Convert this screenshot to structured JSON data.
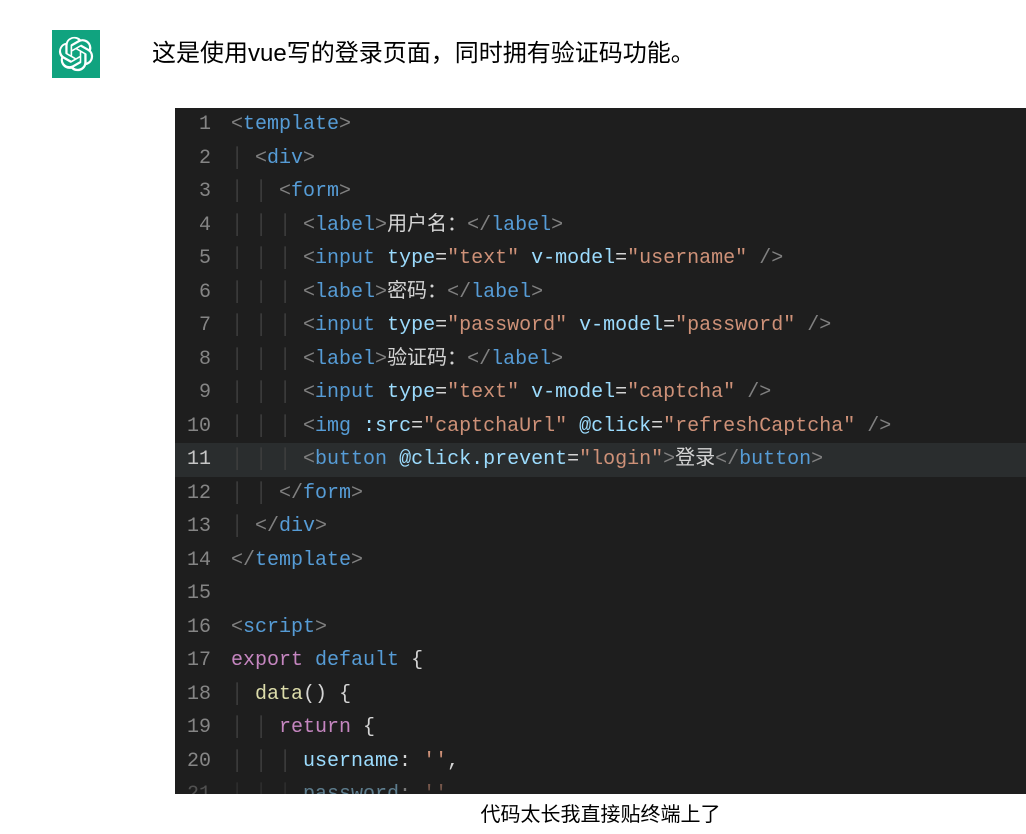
{
  "message": {
    "text": "这是使用vue写的登录页面，同时拥有验证码功能。"
  },
  "caption": "代码太长我直接贴终端上了",
  "code": {
    "lines": [
      {
        "n": "1",
        "indent": "",
        "tokens": [
          {
            "t": "tag-bracket",
            "v": "<"
          },
          {
            "t": "tag-name",
            "v": "template"
          },
          {
            "t": "tag-bracket",
            "v": ">"
          }
        ]
      },
      {
        "n": "2",
        "indent": "│ ",
        "tokens": [
          {
            "t": "tag-bracket",
            "v": "<"
          },
          {
            "t": "tag-name",
            "v": "div"
          },
          {
            "t": "tag-bracket",
            "v": ">"
          }
        ]
      },
      {
        "n": "3",
        "indent": "│ │ ",
        "tokens": [
          {
            "t": "tag-bracket",
            "v": "<"
          },
          {
            "t": "tag-name",
            "v": "form"
          },
          {
            "t": "tag-bracket",
            "v": ">"
          }
        ]
      },
      {
        "n": "4",
        "indent": "│ │ │ ",
        "tokens": [
          {
            "t": "tag-bracket",
            "v": "<"
          },
          {
            "t": "tag-name",
            "v": "label"
          },
          {
            "t": "tag-bracket",
            "v": ">"
          },
          {
            "t": "text-content",
            "v": "用户名："
          },
          {
            "t": "tag-bracket",
            "v": "</"
          },
          {
            "t": "tag-name",
            "v": "label"
          },
          {
            "t": "tag-bracket",
            "v": ">"
          }
        ]
      },
      {
        "n": "5",
        "indent": "│ │ │ ",
        "tokens": [
          {
            "t": "tag-bracket",
            "v": "<"
          },
          {
            "t": "tag-name",
            "v": "input"
          },
          {
            "t": "text-content",
            "v": " "
          },
          {
            "t": "attr-name",
            "v": "type"
          },
          {
            "t": "eq",
            "v": "="
          },
          {
            "t": "attr-value",
            "v": "\"text\""
          },
          {
            "t": "text-content",
            "v": " "
          },
          {
            "t": "attr-name",
            "v": "v-model"
          },
          {
            "t": "eq",
            "v": "="
          },
          {
            "t": "attr-value",
            "v": "\"username\""
          },
          {
            "t": "text-content",
            "v": " "
          },
          {
            "t": "tag-bracket",
            "v": "/>"
          }
        ]
      },
      {
        "n": "6",
        "indent": "│ │ │ ",
        "tokens": [
          {
            "t": "tag-bracket",
            "v": "<"
          },
          {
            "t": "tag-name",
            "v": "label"
          },
          {
            "t": "tag-bracket",
            "v": ">"
          },
          {
            "t": "text-content",
            "v": "密码："
          },
          {
            "t": "tag-bracket",
            "v": "</"
          },
          {
            "t": "tag-name",
            "v": "label"
          },
          {
            "t": "tag-bracket",
            "v": ">"
          }
        ]
      },
      {
        "n": "7",
        "indent": "│ │ │ ",
        "tokens": [
          {
            "t": "tag-bracket",
            "v": "<"
          },
          {
            "t": "tag-name",
            "v": "input"
          },
          {
            "t": "text-content",
            "v": " "
          },
          {
            "t": "attr-name",
            "v": "type"
          },
          {
            "t": "eq",
            "v": "="
          },
          {
            "t": "attr-value",
            "v": "\"password\""
          },
          {
            "t": "text-content",
            "v": " "
          },
          {
            "t": "attr-name",
            "v": "v-model"
          },
          {
            "t": "eq",
            "v": "="
          },
          {
            "t": "attr-value",
            "v": "\"password\""
          },
          {
            "t": "text-content",
            "v": " "
          },
          {
            "t": "tag-bracket",
            "v": "/>"
          }
        ]
      },
      {
        "n": "8",
        "indent": "│ │ │ ",
        "tokens": [
          {
            "t": "tag-bracket",
            "v": "<"
          },
          {
            "t": "tag-name",
            "v": "label"
          },
          {
            "t": "tag-bracket",
            "v": ">"
          },
          {
            "t": "text-content",
            "v": "验证码："
          },
          {
            "t": "tag-bracket",
            "v": "</"
          },
          {
            "t": "tag-name",
            "v": "label"
          },
          {
            "t": "tag-bracket",
            "v": ">"
          }
        ]
      },
      {
        "n": "9",
        "indent": "│ │ │ ",
        "tokens": [
          {
            "t": "tag-bracket",
            "v": "<"
          },
          {
            "t": "tag-name",
            "v": "input"
          },
          {
            "t": "text-content",
            "v": " "
          },
          {
            "t": "attr-name",
            "v": "type"
          },
          {
            "t": "eq",
            "v": "="
          },
          {
            "t": "attr-value",
            "v": "\"text\""
          },
          {
            "t": "text-content",
            "v": " "
          },
          {
            "t": "attr-name",
            "v": "v-model"
          },
          {
            "t": "eq",
            "v": "="
          },
          {
            "t": "attr-value",
            "v": "\"captcha\""
          },
          {
            "t": "text-content",
            "v": " "
          },
          {
            "t": "tag-bracket",
            "v": "/>"
          }
        ]
      },
      {
        "n": "10",
        "indent": "│ │ │ ",
        "tokens": [
          {
            "t": "tag-bracket",
            "v": "<"
          },
          {
            "t": "tag-name",
            "v": "img"
          },
          {
            "t": "text-content",
            "v": " "
          },
          {
            "t": "attr-name",
            "v": ":src"
          },
          {
            "t": "eq",
            "v": "="
          },
          {
            "t": "attr-value",
            "v": "\"captchaUrl\""
          },
          {
            "t": "text-content",
            "v": " "
          },
          {
            "t": "attr-name",
            "v": "@click"
          },
          {
            "t": "eq",
            "v": "="
          },
          {
            "t": "attr-value",
            "v": "\"refreshCaptcha\""
          },
          {
            "t": "text-content",
            "v": " "
          },
          {
            "t": "tag-bracket",
            "v": "/>"
          }
        ]
      },
      {
        "n": "11",
        "indent": "│ │ │ ",
        "highlighted": true,
        "tokens": [
          {
            "t": "tag-bracket",
            "v": "<"
          },
          {
            "t": "tag-name",
            "v": "button"
          },
          {
            "t": "text-content",
            "v": " "
          },
          {
            "t": "attr-name",
            "v": "@click.prevent"
          },
          {
            "t": "eq",
            "v": "="
          },
          {
            "t": "attr-value",
            "v": "\"login\""
          },
          {
            "t": "tag-bracket",
            "v": ">"
          },
          {
            "t": "text-content",
            "v": "登录"
          },
          {
            "t": "tag-bracket",
            "v": "</"
          },
          {
            "t": "tag-name",
            "v": "button"
          },
          {
            "t": "tag-bracket",
            "v": ">"
          }
        ]
      },
      {
        "n": "12",
        "indent": "│ │ ",
        "tokens": [
          {
            "t": "tag-bracket",
            "v": "</"
          },
          {
            "t": "tag-name",
            "v": "form"
          },
          {
            "t": "tag-bracket",
            "v": ">"
          }
        ]
      },
      {
        "n": "13",
        "indent": "│ ",
        "tokens": [
          {
            "t": "tag-bracket",
            "v": "</"
          },
          {
            "t": "tag-name",
            "v": "div"
          },
          {
            "t": "tag-bracket",
            "v": ">"
          }
        ]
      },
      {
        "n": "14",
        "indent": "",
        "tokens": [
          {
            "t": "tag-bracket",
            "v": "</"
          },
          {
            "t": "tag-name",
            "v": "template"
          },
          {
            "t": "tag-bracket",
            "v": ">"
          }
        ]
      },
      {
        "n": "15",
        "indent": "",
        "tokens": []
      },
      {
        "n": "16",
        "indent": "",
        "tokens": [
          {
            "t": "tag-bracket",
            "v": "<"
          },
          {
            "t": "tag-name",
            "v": "script"
          },
          {
            "t": "tag-bracket",
            "v": ">"
          }
        ]
      },
      {
        "n": "17",
        "indent": "",
        "tokens": [
          {
            "t": "kw-export",
            "v": "export"
          },
          {
            "t": "text-content",
            "v": " "
          },
          {
            "t": "kw-default",
            "v": "default"
          },
          {
            "t": "text-content",
            "v": " "
          },
          {
            "t": "brace",
            "v": "{"
          }
        ]
      },
      {
        "n": "18",
        "indent": "│ ",
        "tokens": [
          {
            "t": "fn-name",
            "v": "data"
          },
          {
            "t": "punct",
            "v": "()"
          },
          {
            "t": "text-content",
            "v": " "
          },
          {
            "t": "brace",
            "v": "{"
          }
        ]
      },
      {
        "n": "19",
        "indent": "│ │ ",
        "tokens": [
          {
            "t": "kw-return",
            "v": "return"
          },
          {
            "t": "text-content",
            "v": " "
          },
          {
            "t": "brace",
            "v": "{"
          }
        ]
      },
      {
        "n": "20",
        "indent": "│ │ │ ",
        "tokens": [
          {
            "t": "prop-name",
            "v": "username"
          },
          {
            "t": "punct",
            "v": ":"
          },
          {
            "t": "text-content",
            "v": " "
          },
          {
            "t": "string",
            "v": "''"
          },
          {
            "t": "comma",
            "v": ","
          }
        ]
      },
      {
        "n": "21",
        "indent": "│ │ │ ",
        "partial": true,
        "tokens": [
          {
            "t": "prop-name",
            "v": "password"
          },
          {
            "t": "punct",
            "v": ":"
          },
          {
            "t": "text-content",
            "v": " "
          },
          {
            "t": "string",
            "v": "''"
          }
        ]
      }
    ]
  }
}
